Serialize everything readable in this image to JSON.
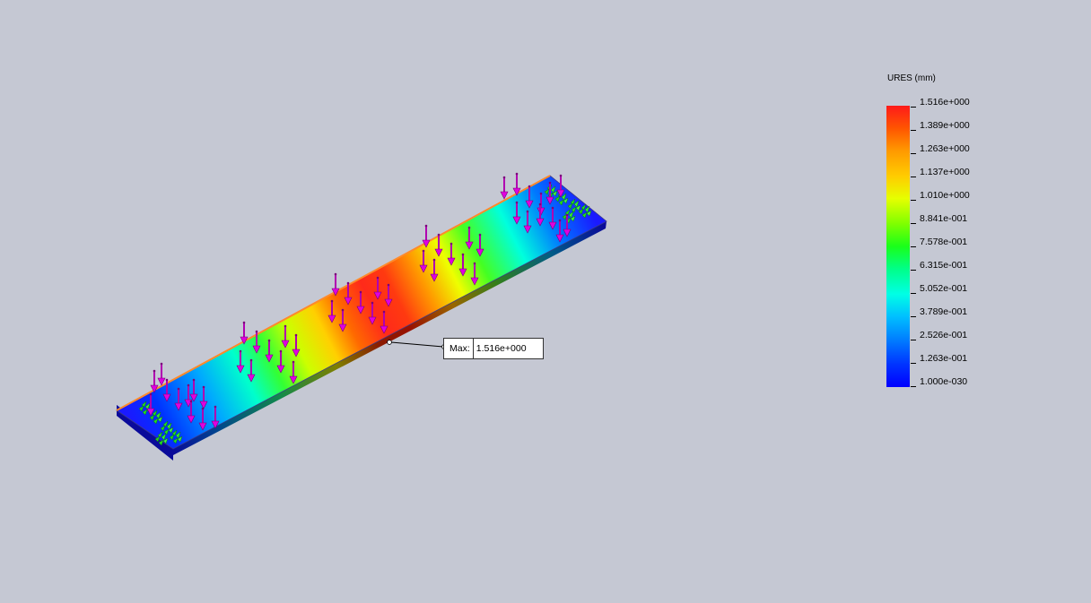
{
  "legend": {
    "title": "URES (mm)",
    "ticks": [
      "1.516e+000",
      "1.389e+000",
      "1.263e+000",
      "1.137e+000",
      "1.010e+000",
      "8.841e-001",
      "7.578e-001",
      "6.315e-001",
      "5.052e-001",
      "3.789e-001",
      "2.526e-001",
      "1.263e-001",
      "1.000e-030"
    ]
  },
  "probe": {
    "label": "Max:",
    "value": "1.516e+000"
  },
  "colors": {
    "background": "#c5c8d3",
    "load_arrow": "#cc00cc",
    "fixture": "#22dd22",
    "min": "#0000ff",
    "max": "#ff1a1a"
  },
  "icons": {
    "load": "downward-force-arrow",
    "fixture": "fixed-geometry-marker"
  }
}
